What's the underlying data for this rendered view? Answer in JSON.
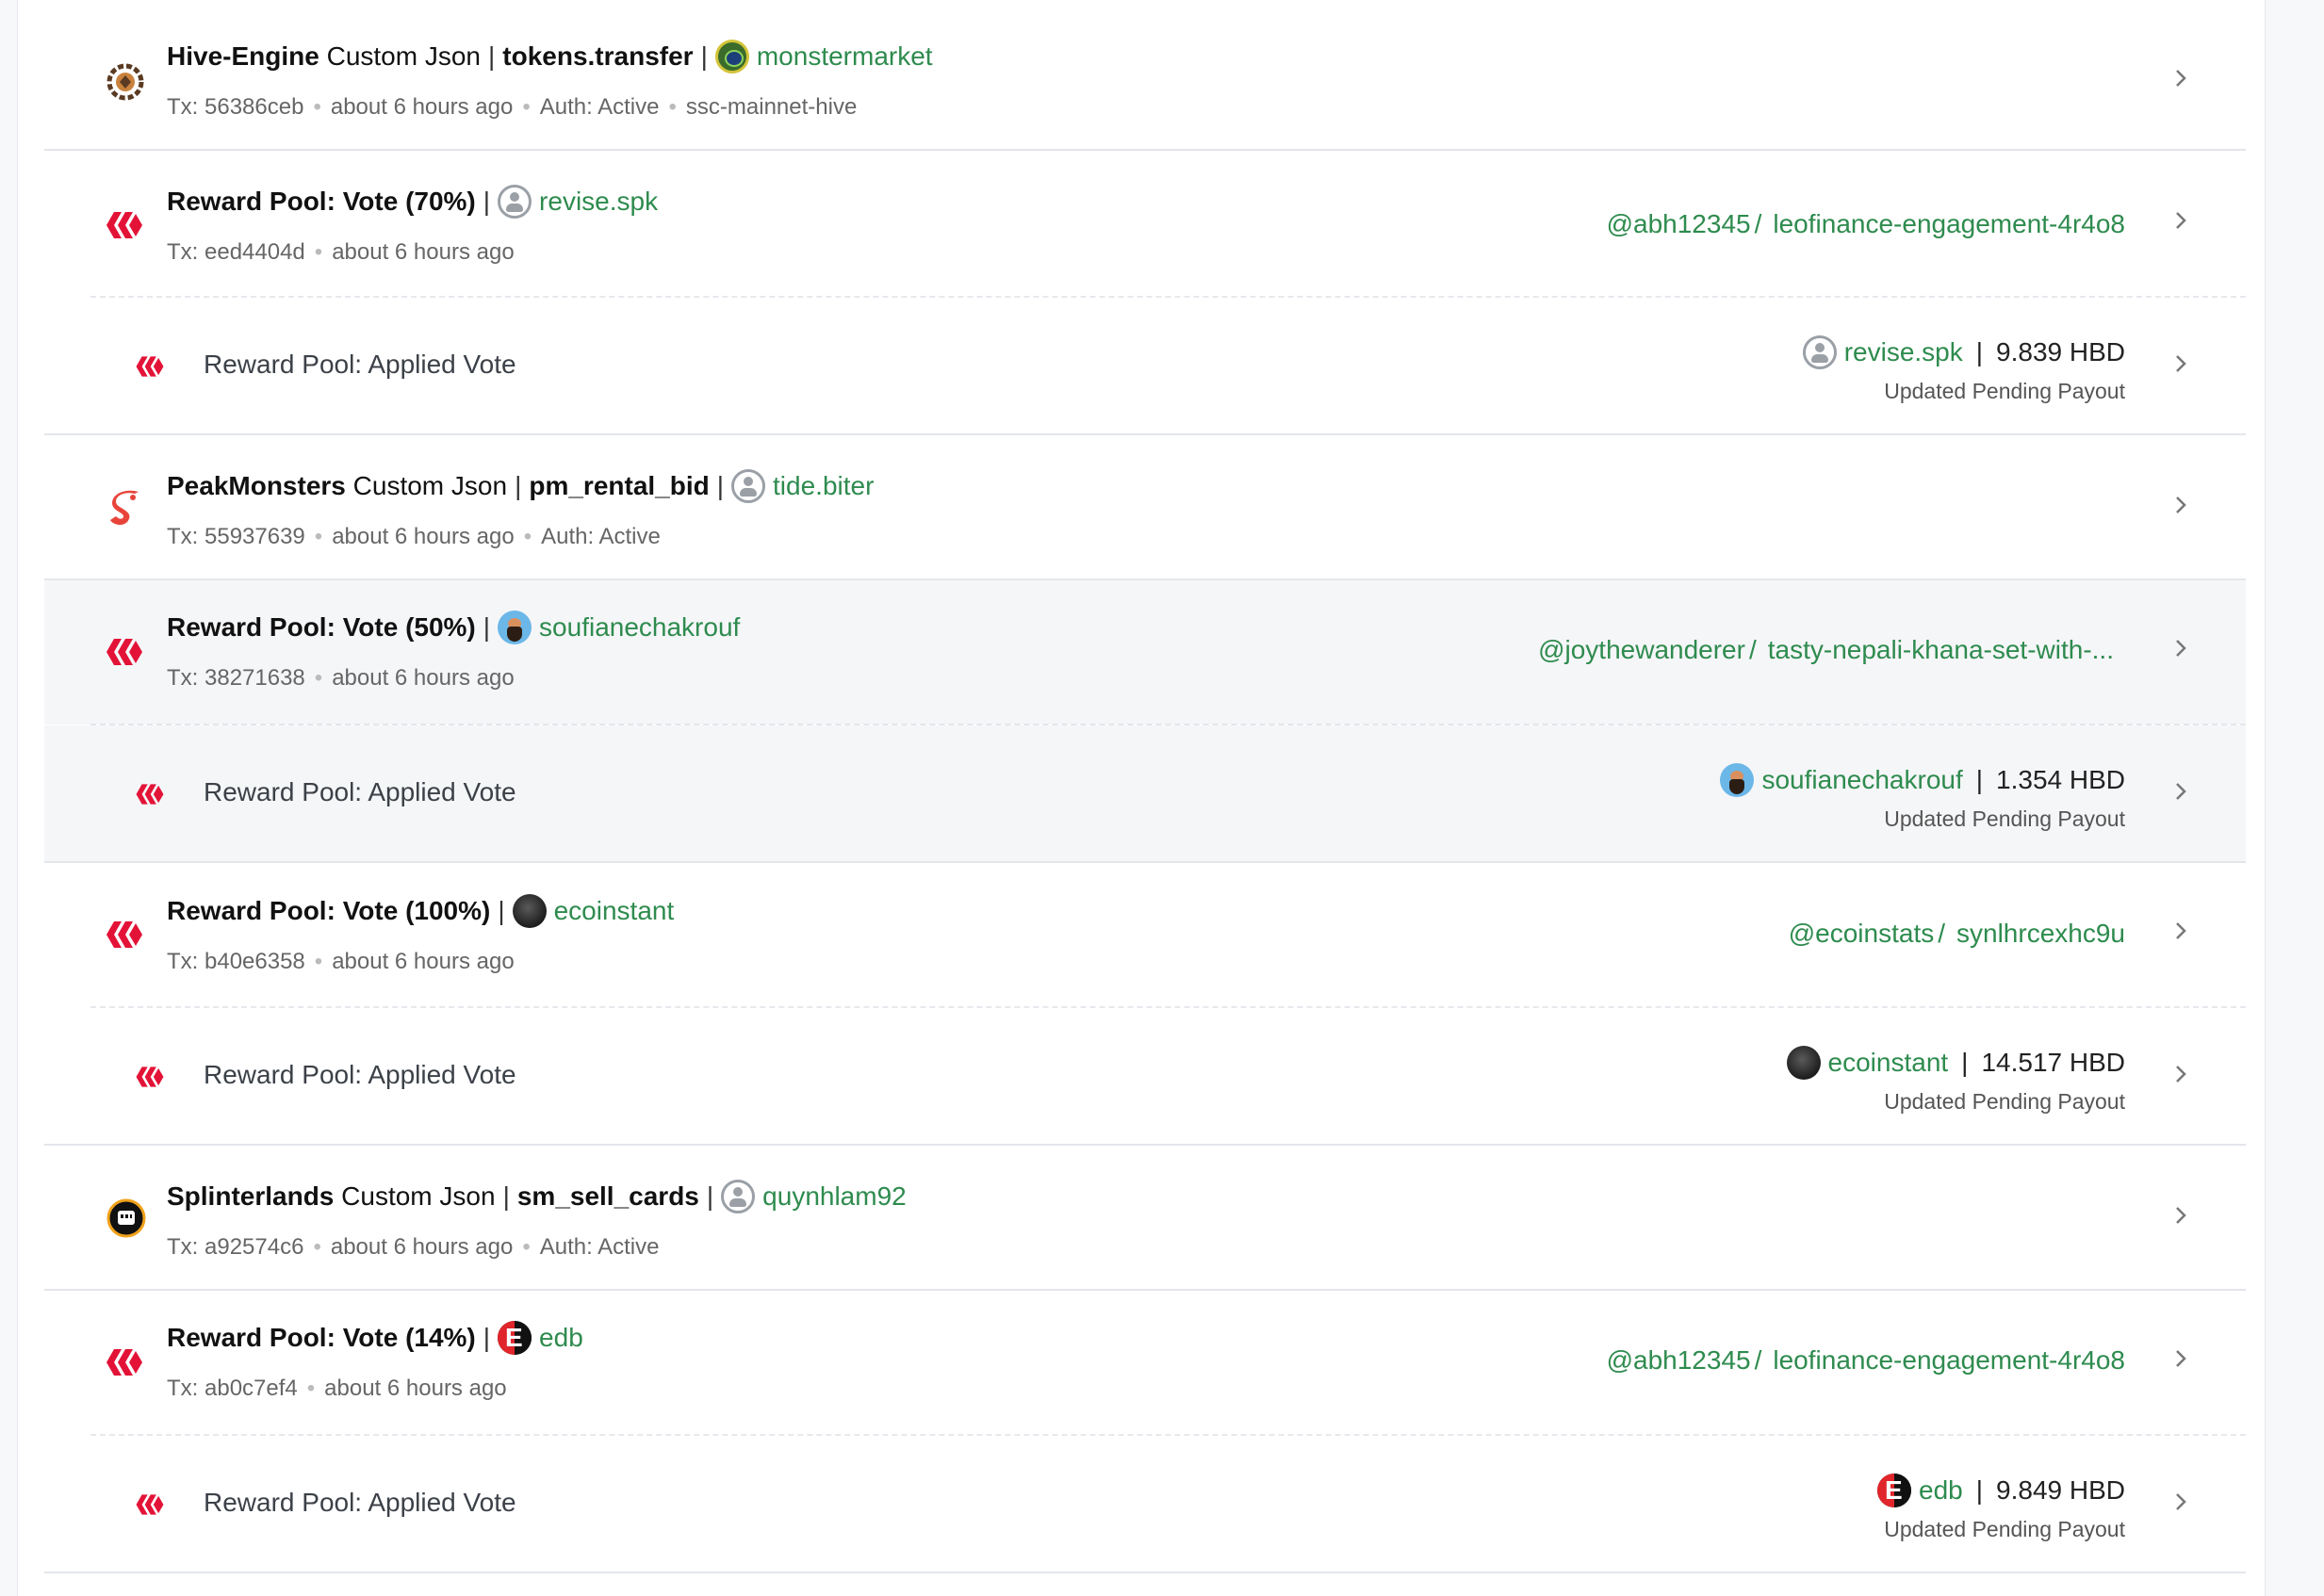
{
  "operations": [
    {
      "kind": "custom",
      "icon": "hive-engine-icon",
      "app": "Hive-Engine",
      "label": "Custom Json",
      "op_id": "tokens.transfer",
      "account": "monstermarket",
      "tx": "Tx: 56386ceb",
      "time": "about 6 hours ago",
      "auth": "Auth: Active",
      "extra": "ssc-mainnet-hive"
    },
    {
      "kind": "vote",
      "title": "Reward Pool: Vote (70%)",
      "account": "revise.spk",
      "tx": "Tx: eed4404d",
      "time": "about 6 hours ago",
      "author": "@abh12345",
      "permlink": "leofinance-engagement-4r4o8",
      "applied": {
        "label": "Reward Pool: Applied Vote",
        "account": "revise.spk",
        "amount": "9.839 HBD",
        "note": "Updated Pending Payout"
      }
    },
    {
      "kind": "custom",
      "icon": "peakmonsters-icon",
      "app": "PeakMonsters",
      "label": "Custom Json",
      "op_id": "pm_rental_bid",
      "account": "tide.biter",
      "tx": "Tx: 55937639",
      "time": "about 6 hours ago",
      "auth": "Auth: Active"
    },
    {
      "kind": "vote",
      "title": "Reward Pool: Vote (50%)",
      "account": "soufianechakrouf",
      "tx": "Tx: 38271638",
      "time": "about 6 hours ago",
      "author": "@joythewanderer",
      "permlink": "tasty-nepali-khana-set-with-...",
      "applied": {
        "label": "Reward Pool: Applied Vote",
        "account": "soufianechakrouf",
        "amount": "1.354 HBD",
        "note": "Updated Pending Payout"
      }
    },
    {
      "kind": "vote",
      "title": "Reward Pool: Vote (100%)",
      "account": "ecoinstant",
      "tx": "Tx: b40e6358",
      "time": "about 6 hours ago",
      "author": "@ecoinstats",
      "permlink": "synlhrcexhc9u",
      "applied": {
        "label": "Reward Pool: Applied Vote",
        "account": "ecoinstant",
        "amount": "14.517 HBD",
        "note": "Updated Pending Payout"
      }
    },
    {
      "kind": "custom",
      "icon": "splinterlands-icon",
      "app": "Splinterlands",
      "label": "Custom Json",
      "op_id": "sm_sell_cards",
      "account": "quynhlam92",
      "tx": "Tx: a92574c6",
      "time": "about 6 hours ago",
      "auth": "Auth: Active"
    },
    {
      "kind": "vote",
      "title": "Reward Pool: Vote (14%)",
      "account": "edb",
      "tx": "Tx: ab0c7ef4",
      "time": "about 6 hours ago",
      "author": "@abh12345",
      "permlink": "leofinance-engagement-4r4o8",
      "applied": {
        "label": "Reward Pool: Applied Vote",
        "account": "edb",
        "amount": "9.849 HBD",
        "note": "Updated Pending Payout"
      }
    }
  ],
  "colors": {
    "accent": "#2e8b4e",
    "hive_red": "#e31337",
    "muted": "#666666"
  }
}
